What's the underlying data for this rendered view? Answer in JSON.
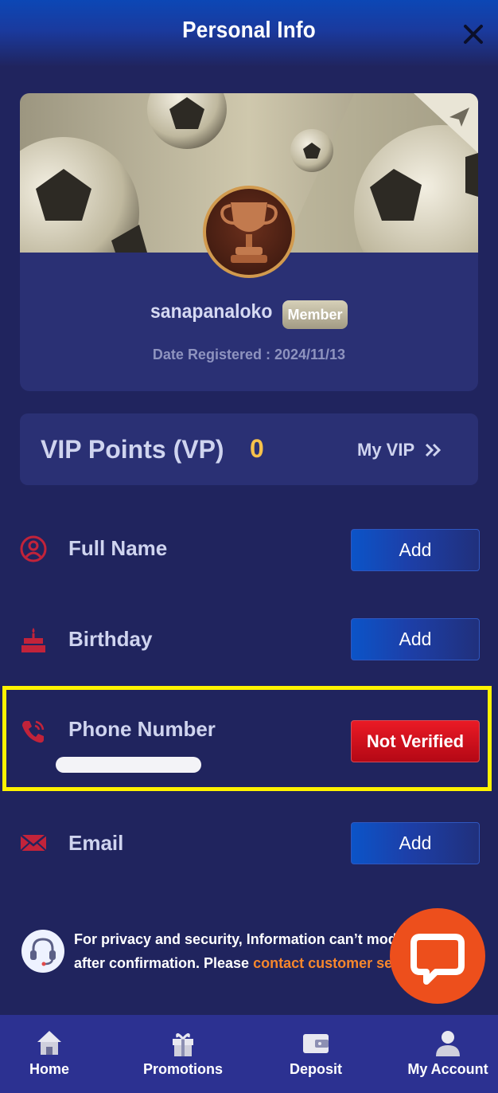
{
  "header": {
    "title": "Personal Info"
  },
  "profile": {
    "username": "sanapanaloko",
    "badge": "Member",
    "date_registered": "Date Registered : 2024/11/13"
  },
  "vip": {
    "label": "VIP Points (VP)",
    "value": "0",
    "my_vip": "My VIP"
  },
  "fields": {
    "full_name": {
      "label": "Full Name",
      "action": "Add"
    },
    "birthday": {
      "label": "Birthday",
      "action": "Add"
    },
    "phone": {
      "label": "Phone Number",
      "action": "Not Verified"
    },
    "email": {
      "label": "Email",
      "action": "Add"
    }
  },
  "privacy": {
    "line1": "For privacy and security, Information can’t modified",
    "line2_prefix": "after confirmation. Please ",
    "link": "contact customer service"
  },
  "nav": {
    "home": "Home",
    "promotions": "Promotions",
    "deposit": "Deposit",
    "account": "My Account"
  },
  "colors": {
    "background": "#20245e",
    "card": "#2a3074",
    "accent_gold": "#f6c14b",
    "danger": "#d80e1b",
    "chat": "#ed4f1c",
    "highlight": "#fff200"
  }
}
